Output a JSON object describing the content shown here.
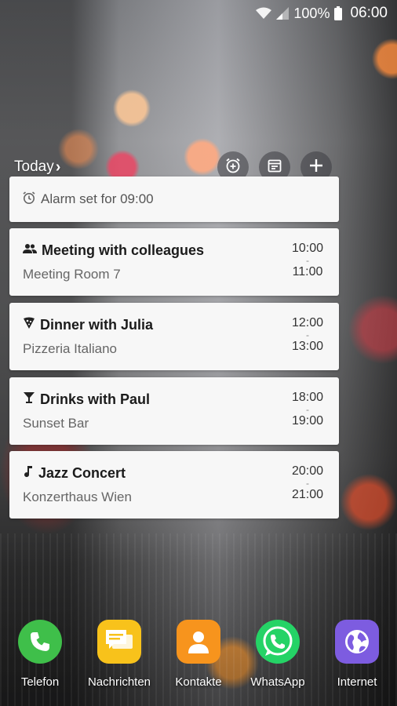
{
  "status_bar": {
    "battery": "100%",
    "time": "06:00"
  },
  "widget": {
    "header_label": "Today",
    "header_chevron": "›",
    "actions": [
      {
        "icon": "alarm-add-icon"
      },
      {
        "icon": "calendar-event-icon"
      },
      {
        "icon": "plus-icon"
      }
    ],
    "alarm": {
      "icon": "alarm-clock-icon",
      "text": "Alarm set for 09:00"
    },
    "events": [
      {
        "icon": "people-icon",
        "title": "Meeting with colleagues",
        "location": "Meeting Room 7",
        "start": "10:00",
        "end": "11:00",
        "sep": "-"
      },
      {
        "icon": "pizza-icon",
        "title": "Dinner with Julia",
        "location": "Pizzeria Italiano",
        "start": "12:00",
        "end": "13:00",
        "sep": "-"
      },
      {
        "icon": "cocktail-icon",
        "title": "Drinks with Paul",
        "location": "Sunset Bar",
        "start": "18:00",
        "end": "19:00",
        "sep": "-"
      },
      {
        "icon": "music-note-icon",
        "title": "Jazz Concert",
        "location": "Konzerthaus Wien",
        "start": "20:00",
        "end": "21:00",
        "sep": "-"
      }
    ]
  },
  "dock": {
    "apps": [
      {
        "label": "Telefon",
        "icon": "phone-icon",
        "color": "#3fbf4a"
      },
      {
        "label": "Nachrichten",
        "icon": "messages-icon",
        "color": "#f8c21b"
      },
      {
        "label": "Kontakte",
        "icon": "contacts-icon",
        "color": "#f7941d"
      },
      {
        "label": "WhatsApp",
        "icon": "whatsapp-icon",
        "color": "#25d366"
      },
      {
        "label": "Internet",
        "icon": "globe-icon",
        "color": "#7d5ce0"
      }
    ]
  }
}
